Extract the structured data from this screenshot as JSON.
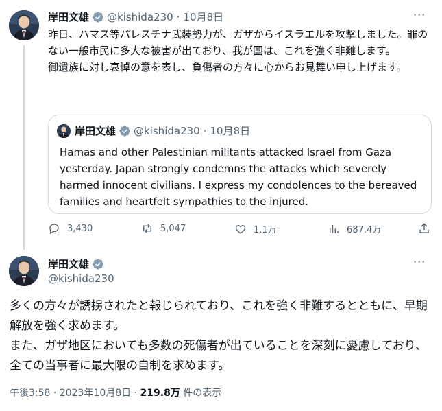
{
  "author": {
    "name": "岸田文雄",
    "handle": "@kishida230",
    "verified_badge_icon": "verified-check-icon",
    "badge_color": "#829aab"
  },
  "first_tweet": {
    "date": "10月8日",
    "dot": "·",
    "paragraphs": [
      "昨日、ハマス等パレスチナ武装勢力が、ガザからイスラエルを攻撃しました。罪のない一般市民に多大な被害が出ており、我が国は、これを強く非難します。",
      "御遺族に対し哀悼の意を表し、負傷者の方々に心からお見舞い申し上げます。"
    ],
    "quote": {
      "name": "岸田文雄",
      "handle": "@kishida230",
      "dot": "·",
      "date": "10月8日",
      "text": "Hamas and other Palestinian militants attacked Israel from Gaza yesterday. Japan strongly condemns the attacks which severely harmed innocent civilians. I express my condolences to the bereaved families and heartfelt sympathies to the injured."
    },
    "actions": {
      "replies": "3,430",
      "reposts": "5,047",
      "likes": "1.1万",
      "views": "687.4万"
    }
  },
  "second_tweet": {
    "paragraphs": [
      "多くの方々が誘拐されたと報じられており、これを強く非難するとともに、早期解放を強く求めます。",
      "また、ガザ地区においても多数の死傷者が出ていることを深刻に憂慮しており、全ての当事者に最大限の自制を求めます。"
    ],
    "footer": {
      "time": "午後3:58",
      "separator1": " · ",
      "date": "2023年10月8日",
      "separator2": " · ",
      "views": "219.8万",
      "views_label": " 件の表示"
    }
  },
  "more_icon": "···",
  "colors": {
    "text": "#0f1419",
    "secondary": "#536471",
    "border": "#cfd9de"
  }
}
